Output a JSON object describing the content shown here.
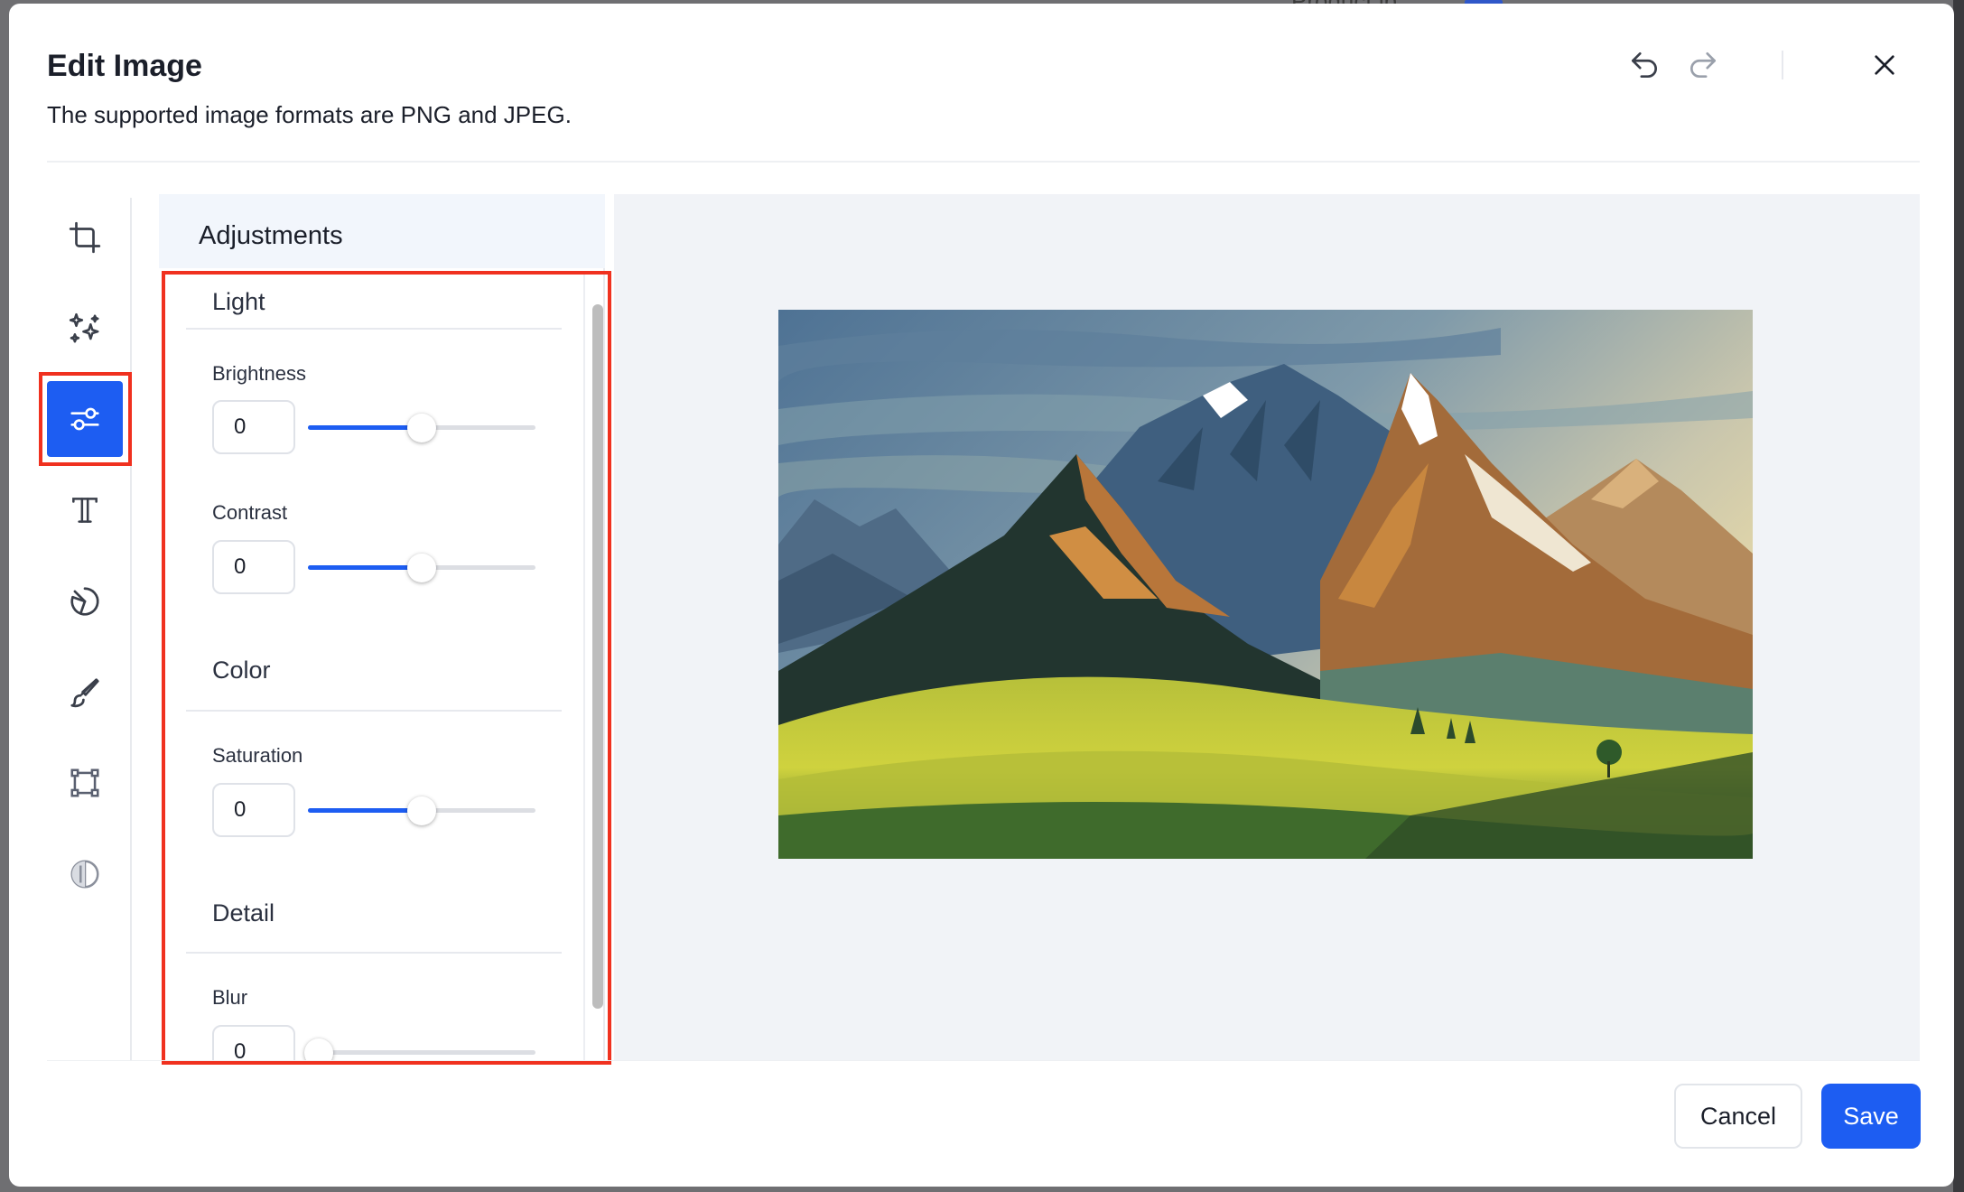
{
  "backdrop": {
    "text": "Product ip"
  },
  "modal": {
    "title": "Edit Image",
    "subtitle": "The supported image formats are PNG and JPEG."
  },
  "header_actions": [
    "undo-icon",
    "redo-icon",
    "close-icon"
  ],
  "tools": [
    {
      "name": "crop-icon",
      "active": false
    },
    {
      "name": "sparkles-icon",
      "active": false
    },
    {
      "name": "sliders-icon",
      "active": true
    },
    {
      "name": "text-icon",
      "active": false
    },
    {
      "name": "shape-icon",
      "active": false
    },
    {
      "name": "brush-icon",
      "active": false
    },
    {
      "name": "frame-icon",
      "active": false
    },
    {
      "name": "contrast-icon",
      "active": false
    }
  ],
  "panel": {
    "title": "Adjustments",
    "sections": {
      "light": "Light",
      "color": "Color",
      "detail": "Detail"
    },
    "brightness": {
      "label": "Brightness",
      "value": "0",
      "slider_fraction": 0.5
    },
    "contrast": {
      "label": "Contrast",
      "value": "0",
      "slider_fraction": 0.5
    },
    "saturation": {
      "label": "Saturation",
      "value": "0",
      "slider_fraction": 0.5
    },
    "blur": {
      "label": "Blur",
      "value": "0",
      "slider_fraction": 0.0
    }
  },
  "colors": {
    "accent": "#1d5df2",
    "highlight": "#f0311f"
  },
  "footer": {
    "cancel_label": "Cancel",
    "save_label": "Save"
  }
}
